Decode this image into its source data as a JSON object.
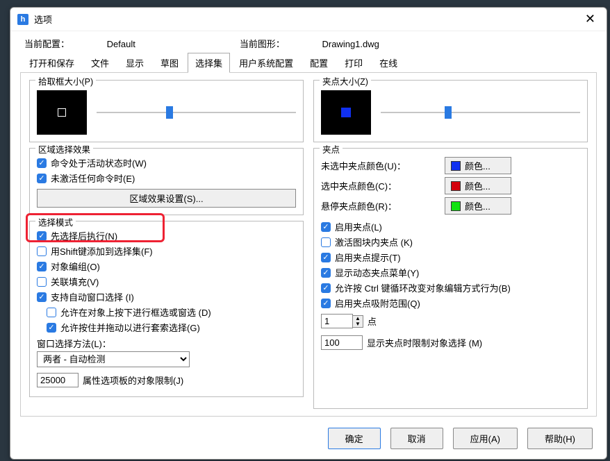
{
  "window": {
    "title": "选项"
  },
  "info": {
    "config_label": "当前配置：",
    "config_value": "Default",
    "drawing_label": "当前图形：",
    "drawing_value": "Drawing1.dwg"
  },
  "tabs": [
    "打开和保存",
    "文件",
    "显示",
    "草图",
    "选择集",
    "用户系统配置",
    "配置",
    "打印",
    "在线"
  ],
  "active_tab": 4,
  "left": {
    "pickbox_title": "拾取框大小(P)",
    "region_title": "区域选择效果",
    "region_cb1": "命令处于活动状态时(W)",
    "region_cb2": "未激活任何命令时(E)",
    "region_btn": "区域效果设置(S)...",
    "selmode_title": "选择模式",
    "cb_presel": "先选择后执行(N)",
    "cb_shift": "用Shift键添加到选择集(F)",
    "cb_group": "对象编组(O)",
    "cb_hatch": "关联填充(V)",
    "cb_autowin": "支持自动窗口选择 (I)",
    "cb_autowin_a": "允许在对象上按下进行框选或窗选 (D)",
    "cb_autowin_b": "允许按住并拖动以进行套索选择(G)",
    "winmethod_label": "窗口选择方法(L)：",
    "winmethod_value": "两者 - 自动检测",
    "proplimit_value": "25000",
    "proplimit_label": "属性选项板的对象限制(J)"
  },
  "right": {
    "grip_title": "夹点大小(Z)",
    "grips_section": "夹点",
    "color_unsel": "未选中夹点颜色(U)：",
    "color_sel": "选中夹点颜色(C)：",
    "color_hover": "悬停夹点颜色(R)：",
    "color_btn": "颜色...",
    "swatches": {
      "unsel": "#1030f0",
      "sel": "#d4000c",
      "hover": "#11e311"
    },
    "cb_enable": "启用夹点(L)",
    "cb_block": "激活图块内夹点 (K)",
    "cb_tips": "启用夹点提示(T)",
    "cb_dynmenu": "显示动态夹点菜单(Y)",
    "cb_ctrl": "允许按 Ctrl 键循环改变对象编辑方式行为(B)",
    "cb_snap": "启用夹点吸附范围(Q)",
    "spin_value": "1",
    "spin_label": "点",
    "limit_value": "100",
    "limit_label": "显示夹点时限制对象选择 (M)"
  },
  "footer": {
    "ok": "确定",
    "cancel": "取消",
    "apply": "应用(A)",
    "help": "帮助(H)"
  }
}
